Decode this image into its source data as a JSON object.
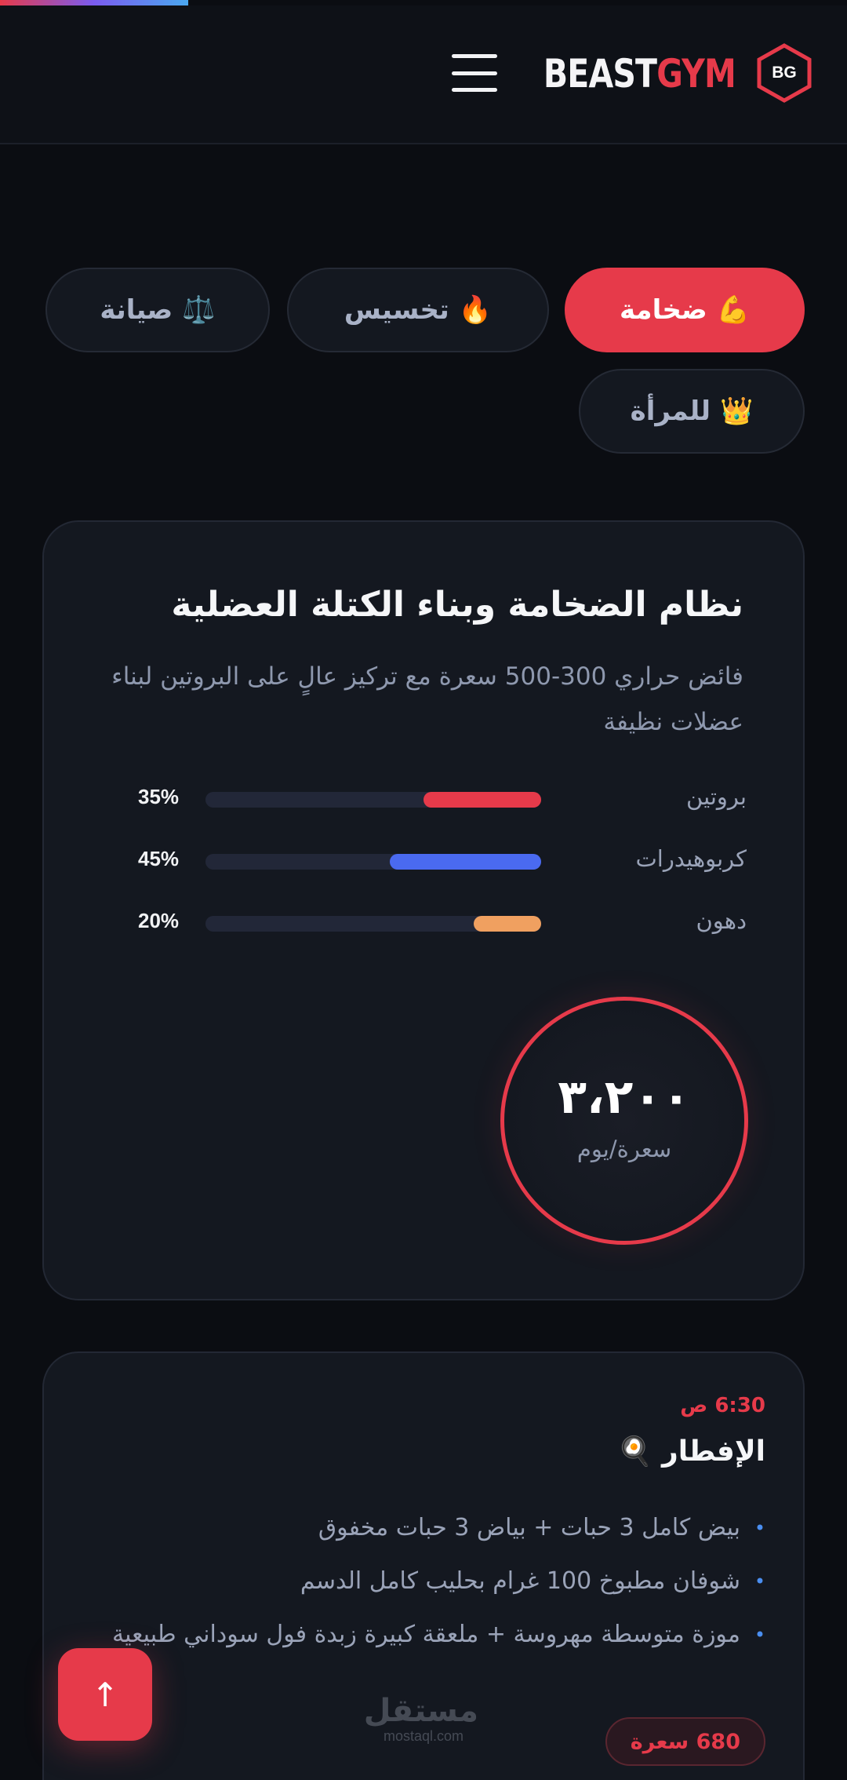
{
  "brand": {
    "name_white": "BEAST",
    "name_red": "GYM",
    "badge": "BG"
  },
  "tabs": [
    {
      "emoji": "💪",
      "label": "ضخامة",
      "active": true
    },
    {
      "emoji": "🔥",
      "label": "تخسيس",
      "active": false
    },
    {
      "emoji": "⚖️",
      "label": "صيانة",
      "active": false
    },
    {
      "emoji": "👑",
      "label": "للمرأة",
      "active": false
    }
  ],
  "plan": {
    "title": "نظام الضخامة وبناء الكتلة العضلية",
    "description": "فائض حراري 300-500 سعرة مع تركيز عالٍ على البروتين لبناء عضلات نظيفة",
    "macros": [
      {
        "label": "بروتين",
        "percent": 35,
        "percent_text": "35%",
        "color": "#e63a4a"
      },
      {
        "label": "كربوهيدرات",
        "percent": 45,
        "percent_text": "45%",
        "color": "#4a6af0"
      },
      {
        "label": "دهون",
        "percent": 20,
        "percent_text": "20%",
        "color": "#f0a060"
      }
    ],
    "calories_value": "٣،٢٠٠",
    "calories_unit": "سعرة/يوم"
  },
  "meal": {
    "time": "6:30 ص",
    "title": "الإفطار",
    "emoji": "🍳",
    "items": [
      "بيض كامل 3 حبات + بياض 3 حبات مخفوق",
      "شوفان مطبوخ 100 غرام بحليب كامل الدسم",
      "موزة متوسطة مهروسة + ملعقة كبيرة زبدة فول سوداني طبيعية"
    ],
    "calories": "680 سعرة"
  },
  "back_to_top": "↑",
  "watermark": {
    "ar": "مستقل",
    "en": "mostaql.com"
  },
  "colors": {
    "accent": "#e63a4a",
    "background": "#0b0d12",
    "card": "#141820"
  }
}
